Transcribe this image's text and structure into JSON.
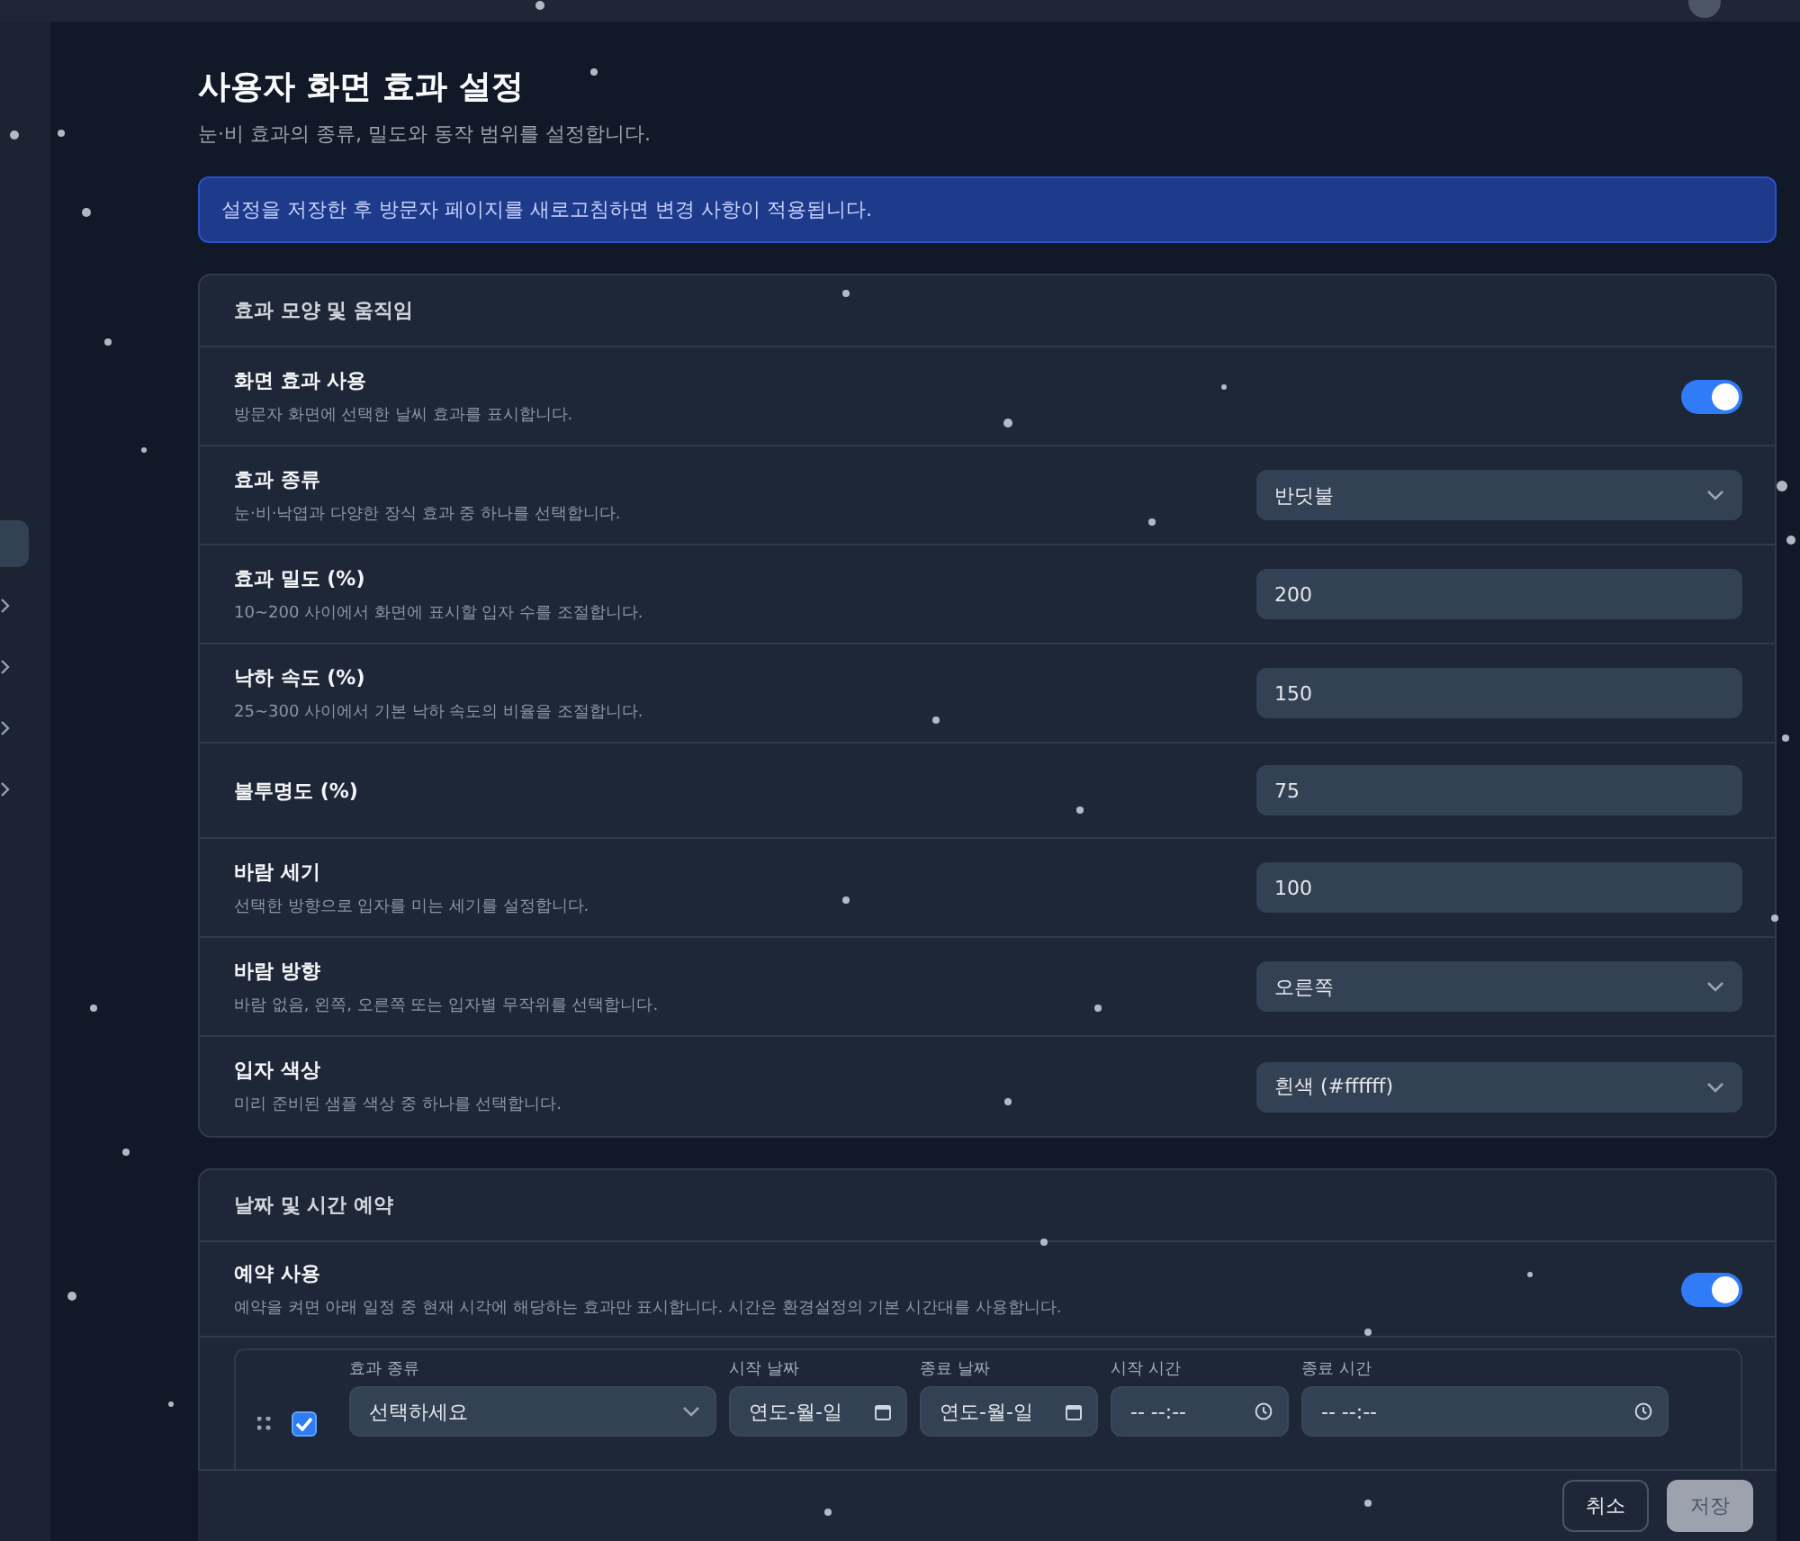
{
  "sidebar": {
    "items": [
      {
        "selected": true,
        "kind": "plain"
      },
      {
        "selected": false,
        "kind": "group"
      },
      {
        "selected": false,
        "kind": "group"
      },
      {
        "selected": false,
        "kind": "group"
      },
      {
        "selected": false,
        "kind": "group"
      }
    ]
  },
  "header": {
    "title": "사용자 화면 효과 설정",
    "subtitle": "눈·비 효과의 종류, 밀도와 동작 범위를 설정합니다."
  },
  "notice": "설정을 저장한 후 방문자 페이지를 새로고침하면 변경 사항이 적용됩니다.",
  "sections": [
    {
      "title": "효과 모양 및 움직임",
      "rows": [
        {
          "kind": "toggle",
          "label": "화면 효과 사용",
          "description": "방문자 화면에 선택한 날씨 효과를 표시합니다.",
          "on": true
        },
        {
          "kind": "select",
          "label": "효과 종류",
          "description": "눈·비·낙엽과 다양한 장식 효과 중 하나를 선택합니다.",
          "value": "반딧불"
        },
        {
          "kind": "input",
          "label": "효과 밀도 (%)",
          "description": "10~200 사이에서 화면에 표시할 입자 수를 조절합니다.",
          "value": "200"
        },
        {
          "kind": "input",
          "label": "낙하 속도 (%)",
          "description": "25~300 사이에서 기본 낙하 속도의 비율을 조절합니다.",
          "value": "150"
        },
        {
          "kind": "input",
          "label": "불투명도 (%)",
          "value": "75"
        },
        {
          "kind": "input",
          "label": "바람 세기",
          "description": "선택한 방향으로 입자를 미는 세기를 설정합니다.",
          "value": "100"
        },
        {
          "kind": "select",
          "label": "바람 방향",
          "description": "바람 없음, 왼쪽, 오른쪽 또는 입자별 무작위를 선택합니다.",
          "value": "오른쪽"
        },
        {
          "kind": "select",
          "label": "입자 색상",
          "description": "미리 준비된 샘플 색상 중 하나를 선택합니다.",
          "value": "흰색 (#ffffff)"
        }
      ]
    },
    {
      "title": "날짜 및 시간 예약",
      "rows": [
        {
          "kind": "toggle",
          "label": "예약 사용",
          "description": "예약을 켜면 아래 일정 중 현재 시각에 해당하는 효과만 표시합니다. 시간은 환경설정의 기본 시간대를 사용합니다.",
          "on": true
        }
      ],
      "schedule": [
        {
          "checked": true,
          "fields": [
            {
              "kind": "select",
              "label": "효과 종류",
              "value": "선택하세요"
            },
            {
              "kind": "date",
              "label": "시작 날짜",
              "placeholder": "연도-월-일"
            },
            {
              "kind": "date",
              "label": "종료 날짜",
              "placeholder": "연도-월-일"
            },
            {
              "kind": "time",
              "label": "시작 시간",
              "placeholder": "-- --:--"
            },
            {
              "kind": "time",
              "label": "종료 시간",
              "placeholder": "-- --:--"
            }
          ]
        }
      ]
    }
  ],
  "footer": {
    "buttons": [
      {
        "label": "취소",
        "kind": "secondary",
        "disabled": false
      },
      {
        "label": "저장",
        "kind": "primary",
        "disabled": true
      }
    ]
  }
}
